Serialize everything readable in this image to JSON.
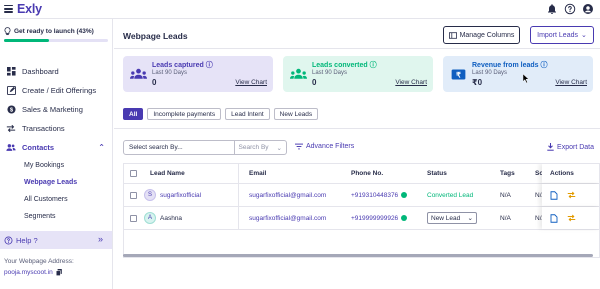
{
  "app": {
    "logo": "Exly"
  },
  "sidebar": {
    "launch_text": "Get ready to launch (43%)",
    "launch_progress": 0.43,
    "items": [
      {
        "label": "Dashboard"
      },
      {
        "label": "Create / Edit Offerings"
      },
      {
        "label": "Sales & Marketing"
      },
      {
        "label": "Transactions"
      },
      {
        "label": "Contacts"
      }
    ],
    "sub_items": [
      {
        "label": "My Bookings"
      },
      {
        "label": "Webpage Leads"
      },
      {
        "label": "All Customers"
      },
      {
        "label": "Segments"
      }
    ],
    "help_label": "Help ?",
    "webpage_address_label": "Your Webpage Address:",
    "webpage_address": "pooja.myscoot.in"
  },
  "header": {
    "title": "Webpage Leads",
    "manage_columns": "Manage Columns",
    "import_leads": "Import Leads"
  },
  "stats": [
    {
      "title": "Leads captured",
      "sub": "Last 90 Days",
      "value": "0",
      "link": "View Chart"
    },
    {
      "title": "Leads converted",
      "sub": "Last 90 Days",
      "value": "0",
      "link": "View Chart"
    },
    {
      "title": "Revenue from leads",
      "sub": "Last 90 Days",
      "value": "₹0",
      "link": "View Chart"
    }
  ],
  "filters": {
    "chips": [
      "All",
      "Incomplete payments",
      "Lead Intent",
      "New Leads"
    ],
    "search_placeholder": "Select search By...",
    "search_by": "Search By",
    "advance_filters": "Advance Filters",
    "export": "Export Data"
  },
  "table": {
    "columns": {
      "name": "Lead Name",
      "email": "Email",
      "phone": "Phone No.",
      "status": "Status",
      "tags": "Tags",
      "so": "So",
      "actions": "Actions"
    },
    "rows": [
      {
        "initial": "S",
        "name": "sugarfixofficial",
        "email": "sugarfixofficial@gmail.com",
        "phone": "+919310448376",
        "status": "Converted Lead",
        "tags": "N/A",
        "so": "N/A"
      },
      {
        "initial": "A",
        "name": "Aashna",
        "email": "sugarfixofficial@gmail.com",
        "phone": "+919999999926",
        "status": "New Lead",
        "tags": "N/A",
        "so": "N/A"
      }
    ]
  },
  "colors": {
    "primary": "#493ab1",
    "success": "#00b779",
    "text": "#272c49"
  }
}
